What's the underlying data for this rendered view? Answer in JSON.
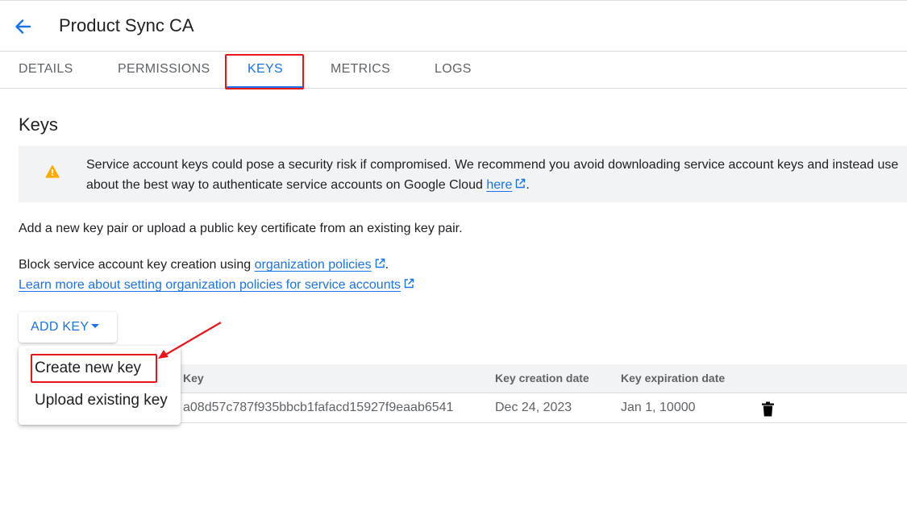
{
  "header": {
    "title": "Product Sync CA",
    "back_icon": "arrow-back-icon"
  },
  "tabs": [
    {
      "label": "DETAILS"
    },
    {
      "label": "PERMISSIONS"
    },
    {
      "label": "KEYS",
      "active": true
    },
    {
      "label": "METRICS"
    },
    {
      "label": "LOGS"
    }
  ],
  "main": {
    "heading": "Keys",
    "warning": {
      "icon": "warning-icon",
      "line1": "Service account keys could pose a security risk if compromised. We recommend you avoid downloading service account keys and instead use",
      "line2_prefix": "about the best way to authenticate service accounts on Google Cloud ",
      "line2_link": "here",
      "line2_suffix": "."
    },
    "intro": "Add a new key pair or upload a public key certificate from an existing key pair.",
    "block_prefix": "Block service account key creation using ",
    "block_link": "organization policies",
    "block_suffix": ".",
    "learn_more_link": "Learn more about setting organization policies for service accounts"
  },
  "add_key": {
    "label": "ADD KEY",
    "menu": [
      "Create new key",
      "Upload existing key"
    ]
  },
  "table": {
    "columns": [
      "Key",
      "Key creation date",
      "Key expiration date"
    ],
    "rows": [
      {
        "key": "a08d57c787f935bbcb1fafacd15927f9eaab6541",
        "created": "Dec 24, 2023",
        "expires": "Jan 1, 10000",
        "action_icon": "trash-icon"
      }
    ]
  },
  "colors": {
    "accent": "#1a73e8",
    "annotation": "#e8151b",
    "warning": "#f9ab00"
  }
}
